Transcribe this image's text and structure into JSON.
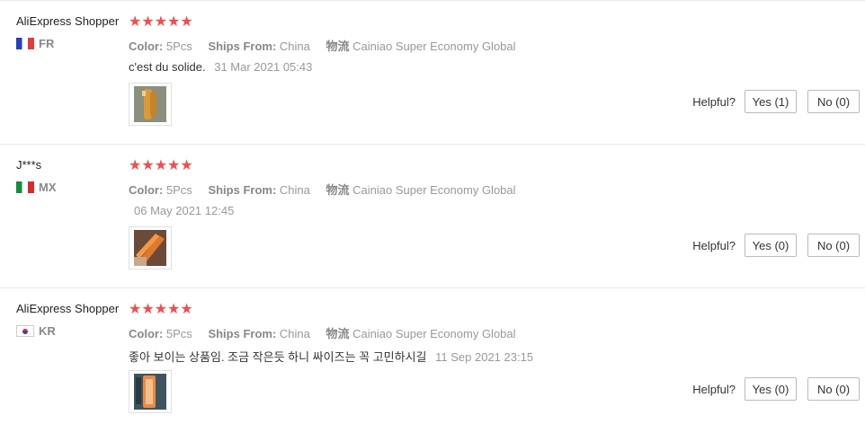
{
  "reviews": [
    {
      "user": "AliExpress Shopper",
      "country": "FR",
      "stars": "★★★★★",
      "color_key": "Color:",
      "color_val": "5Pcs",
      "ships_key": "Ships From:",
      "ships_val": "China",
      "logistics_key": "物流",
      "logistics_val": "Cainiao Super Economy Global",
      "text": "c'est du solide.",
      "date": "31 Mar 2021 05:43",
      "helpful_label": "Helpful?",
      "yes_label": "Yes (1)",
      "no_label": "No (0)"
    },
    {
      "user": "J***s",
      "country": "MX",
      "stars": "★★★★★",
      "color_key": "Color:",
      "color_val": "5Pcs",
      "ships_key": "Ships From:",
      "ships_val": "China",
      "logistics_key": "物流",
      "logistics_val": "Cainiao Super Economy Global",
      "text": "",
      "date": "06 May 2021 12:45",
      "helpful_label": "Helpful?",
      "yes_label": "Yes (0)",
      "no_label": "No (0)"
    },
    {
      "user": "AliExpress Shopper",
      "country": "KR",
      "stars": "★★★★★",
      "color_key": "Color:",
      "color_val": "5Pcs",
      "ships_key": "Ships From:",
      "ships_val": "China",
      "logistics_key": "物流",
      "logistics_val": "Cainiao Super Economy Global",
      "text": "좋아 보이는 상품임. 조금 작은듯 하니 싸이즈는 꼭 고민하시길",
      "date": "11 Sep 2021 23:15",
      "helpful_label": "Helpful?",
      "yes_label": "Yes (0)",
      "no_label": "No (0)"
    }
  ],
  "icons": {
    "flag_fr": "flag-fr-icon",
    "flag_mx": "flag-mx-icon",
    "flag_kr": "flag-kr-icon",
    "star_color": "#f24e4e"
  }
}
